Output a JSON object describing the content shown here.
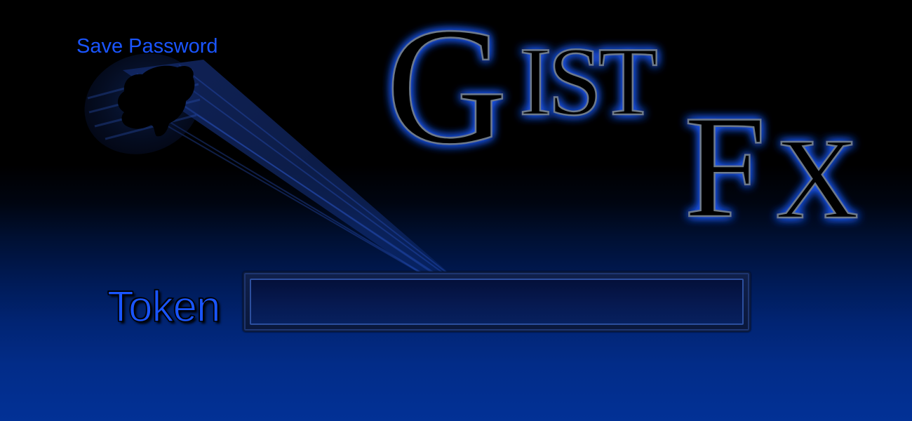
{
  "save_password": {
    "label": "Save Password"
  },
  "logo": {
    "text_part1": "G",
    "text_part2": "IST",
    "text_part3": "F",
    "text_part4": "X",
    "glow_color": "#1f5cff"
  },
  "token": {
    "label": "Token",
    "value": "",
    "placeholder": ""
  },
  "colors": {
    "accent": "#1a55ff",
    "background_top": "#000000",
    "background_bottom": "#023196"
  },
  "icons": {
    "gist_icon": "octocat-silhouette-icon",
    "beam": "light-beam"
  }
}
